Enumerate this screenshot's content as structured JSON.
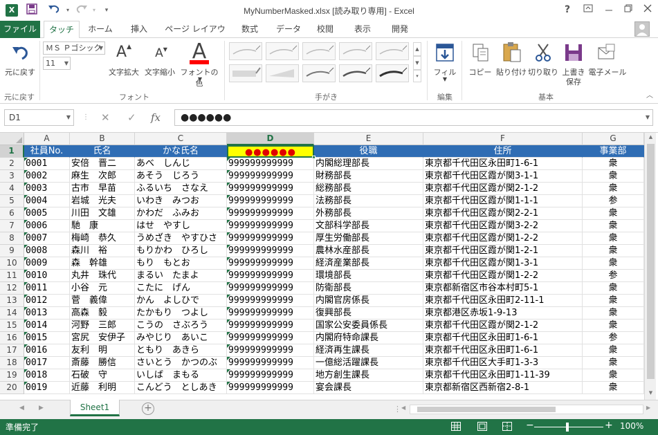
{
  "window": {
    "title": "MyNumberMasked.xlsx  [読み取り専用] - Excel",
    "app_icon": "X",
    "help": "?",
    "controls": [
      "restore-ribbon",
      "minimize",
      "maximize",
      "close"
    ]
  },
  "qat": {
    "save_icon": "save-icon",
    "undo_icon": "undo-icon",
    "redo_icon": "redo-icon"
  },
  "tabs": {
    "file": "ファイル",
    "items": [
      "タッチ",
      "ホーム",
      "挿入",
      "ページ レイアウト",
      "数式",
      "データ",
      "校閲",
      "表示",
      "開発"
    ],
    "active": "タッチ"
  },
  "ribbon": {
    "undo_label": "元に戻す",
    "undo_group": "元に戻す",
    "font_name": "ＭＳ Ｐゴシック",
    "font_size": "11",
    "grow_label": "文字拡大",
    "shrink_label": "文字縮小",
    "font_color_label": "フォントの色",
    "font_group": "フォント",
    "ink_group": "手がき",
    "fill_label": "フィル",
    "edit_group": "編集",
    "copy_label": "コピー",
    "paste_label": "貼り付け",
    "cut_label": "切り取り",
    "save_over_label_1": "上書き",
    "save_over_label_2": "保存",
    "email_label": "電子メール",
    "basic_group": "基本",
    "font_color": "#ff0000",
    "accent": "#217346"
  },
  "formula_bar": {
    "name_box": "D1",
    "cancel": "✕",
    "enter": "✓",
    "fx": "fx",
    "value": "●●●●●●"
  },
  "sheet": {
    "columns": [
      "A",
      "B",
      "C",
      "D",
      "E",
      "F",
      "G"
    ],
    "selected_cell": "D1",
    "header": [
      "社員No.",
      "氏名",
      "かな氏名",
      "●●●●●●",
      "役職",
      "住所",
      "事業部"
    ],
    "rows": [
      [
        "0001",
        "安倍　晋二",
        "あべ　しんじ",
        "999999999999",
        "内閣総理部長",
        "東京都千代田区永田町1-6-1",
        "衆"
      ],
      [
        "0002",
        "麻生　次郎",
        "あそう　じろう",
        "999999999999",
        "財務部長",
        "東京都千代田区霞が関3-1-1",
        "衆"
      ],
      [
        "0003",
        "古市　早苗",
        "ふるいち　さなえ",
        "999999999999",
        "総務部長",
        "東京都千代田区霞が関2-1-2",
        "衆"
      ],
      [
        "0004",
        "岩城　光夫",
        "いわき　みつお",
        "999999999999",
        "法務部長",
        "東京都千代田区霞が関1-1-1",
        "参"
      ],
      [
        "0005",
        "川田　文雄",
        "かわだ　ふみお",
        "999999999999",
        "外務部長",
        "東京都千代田区霞が関2-2-1",
        "衆"
      ],
      [
        "0006",
        "馳　康",
        "はせ　やすし",
        "999999999999",
        "文部科学部長",
        "東京都千代田区霞が関3-2-2",
        "衆"
      ],
      [
        "0007",
        "梅崎　恭久",
        "うめざき　やすひさ",
        "999999999999",
        "厚生労働部長",
        "東京都千代田区霞が関1-2-2",
        "衆"
      ],
      [
        "0008",
        "森川　裕",
        "もりかわ　ひろし",
        "999999999999",
        "農林水産部長",
        "東京都千代田区霞が関1-2-1",
        "衆"
      ],
      [
        "0009",
        "森　幹雄",
        "もり　もとお",
        "999999999999",
        "経済産業部長",
        "東京都千代田区霞が関1-3-1",
        "衆"
      ],
      [
        "0010",
        "丸井　珠代",
        "まるい　たまよ",
        "999999999999",
        "環境部長",
        "東京都千代田区霞が関1-2-2",
        "参"
      ],
      [
        "0011",
        "小谷　元",
        "こたに　げん",
        "999999999999",
        "防衛部長",
        "東京都新宿区市谷本村町5-1",
        "衆"
      ],
      [
        "0012",
        "菅　義偉",
        "かん　よしひで",
        "999999999999",
        "内閣官房係長",
        "東京都千代田区永田町2-11-1",
        "衆"
      ],
      [
        "0013",
        "高森　毅",
        "たかもり　つよし",
        "999999999999",
        "復興部長",
        "東京都港区赤坂1-9-13",
        "衆"
      ],
      [
        "0014",
        "河野　三郎",
        "こうの　さぶろう",
        "999999999999",
        "国家公安委員係長",
        "東京都千代田区霞が関2-1-2",
        "衆"
      ],
      [
        "0015",
        "宮尻　安伊子",
        "みやじり　あいこ",
        "999999999999",
        "内閣府特命課長",
        "東京都千代田区永田町1-6-1",
        "参"
      ],
      [
        "0016",
        "友利　明",
        "ともり　あきら",
        "999999999999",
        "経済再生課長",
        "東京都千代田区永田町1-6-1",
        "衆"
      ],
      [
        "0017",
        "斎藤　勝信",
        "さいとう　かつのぶ",
        "999999999999",
        "一億総活躍課長",
        "東京都千代田区大手町1-3-3",
        "衆"
      ],
      [
        "0018",
        "石破　守",
        "いしば　まもる",
        "999999999999",
        "地方創生課長",
        "東京都千代田区永田町1-11-39",
        "衆"
      ],
      [
        "0019",
        "近藤　利明",
        "こんどう　としあき",
        "999999999999",
        "宴会課長",
        "東京都新宿区西新宿2-8-1",
        "衆"
      ]
    ]
  },
  "sheet_tabs": {
    "active": "Sheet1",
    "add": "+"
  },
  "status": {
    "ready": "準備完了",
    "zoom": "100%",
    "zoom_minus": "−",
    "zoom_plus": "+"
  }
}
